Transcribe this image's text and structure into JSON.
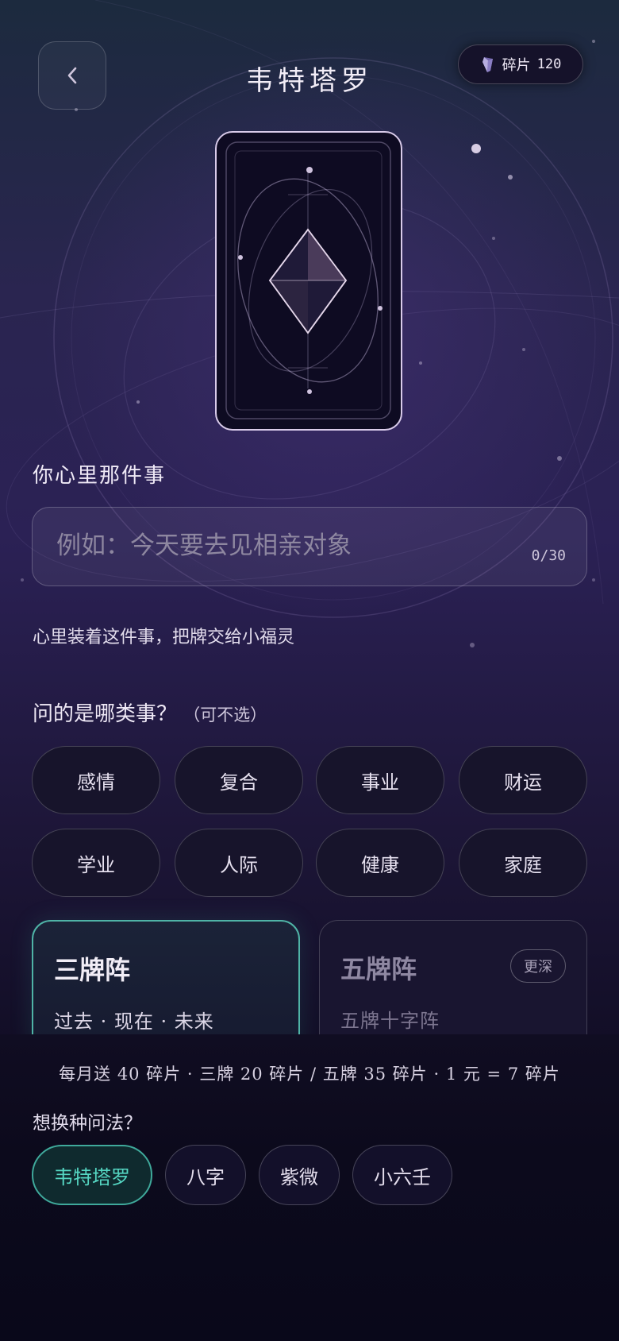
{
  "header": {
    "back_icon": "chevron-left-icon",
    "title": "韦特塔罗",
    "shards": {
      "icon": "crystal-shard-icon",
      "label": "碎片",
      "count": "120"
    }
  },
  "question": {
    "section_label": "你心里那件事",
    "placeholder": "例如：今天要去见相亲对象",
    "value": "",
    "counter": "0/30",
    "hint": "心里装着这件事，把牌交给小福灵"
  },
  "category": {
    "label": "问的是哪类事？",
    "note": "（可不选）",
    "options": [
      "感情",
      "复合",
      "事业",
      "财运",
      "学业",
      "人际",
      "健康",
      "家庭"
    ]
  },
  "spreads": [
    {
      "name": "三牌阵",
      "desc": "过去 · 现在 · 未来",
      "selected": true
    },
    {
      "name": "五牌阵",
      "desc": "五牌十字阵",
      "badge": "更深",
      "selected": false
    }
  ],
  "footer": {
    "pricing": "每月送 40 碎片 · 三牌 20 碎片 / 五牌 35 碎片 · 1 元 = 7 碎片",
    "switch_label": "想换种问法？",
    "methods": [
      "韦特塔罗",
      "八字",
      "紫微",
      "小六壬"
    ],
    "active_method": "韦特塔罗"
  },
  "colors": {
    "accent": "#4fb3a6",
    "accent_text": "#55d6c2",
    "card_border": "#d9cbea"
  }
}
